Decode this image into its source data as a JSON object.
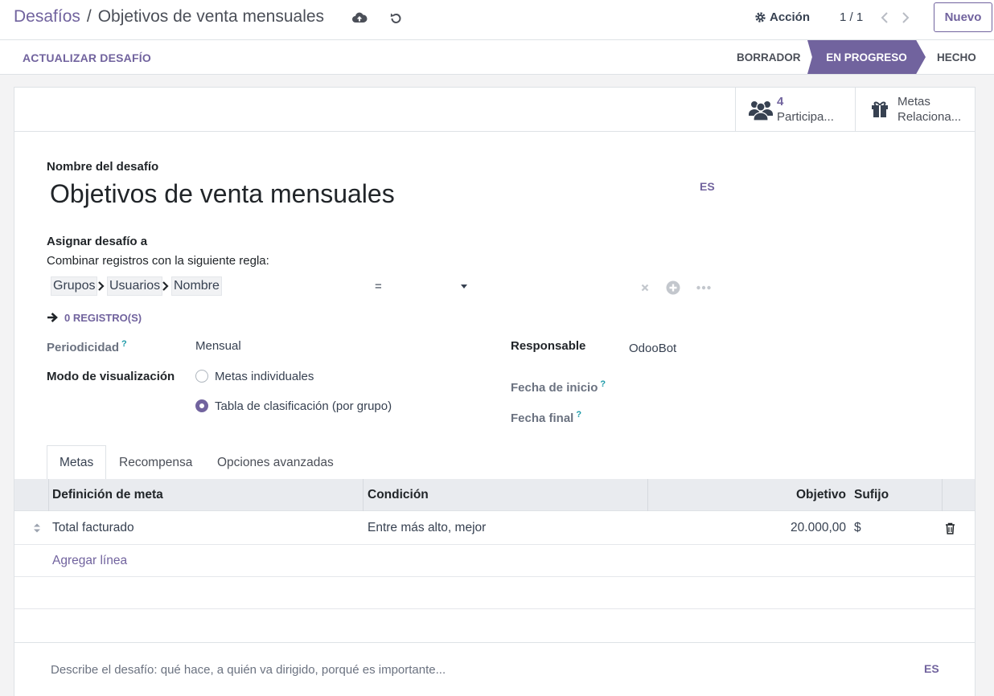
{
  "header": {
    "breadcrumb_parent": "Desafíos",
    "breadcrumb_separator": "/",
    "breadcrumb_current": "Objetivos de venta mensuales",
    "save_icon": "cloud-upload-icon",
    "discard_icon": "undo-icon",
    "action_label": "Acción",
    "pager": "1 / 1",
    "new_label": "Nuevo"
  },
  "statusbar": {
    "update_label": "ACTUALIZAR DESAFÍO",
    "stages": [
      "BORRADOR",
      "EN PROGRESO",
      "HECHO"
    ],
    "active_stage": "EN PROGRESO"
  },
  "smart_buttons": {
    "participants_count": "4",
    "participants_label": "Participa...",
    "goals_label_1": "Metas",
    "goals_label_2": "Relaciona..."
  },
  "form": {
    "name_label": "Nombre del desafío",
    "name_value": "Objetivos de venta mensuales",
    "lang_badge": "ES",
    "assign_label": "Asignar desafío a",
    "rule_label": "Combinar registros con la siguiente regla:",
    "domain_path": [
      "Grupos",
      "Usuarios",
      "Nombre"
    ],
    "domain_operator": "=",
    "records_label": "0 REGISTRO(S)",
    "period_label": "Periodicidad",
    "period_value": "Mensual",
    "display_label": "Modo de visualización",
    "display_options": [
      "Metas individuales",
      "Tabla de clasificación (por grupo)"
    ],
    "display_selected": 1,
    "responsible_label": "Responsable",
    "responsible_value": "OdooBot",
    "start_label": "Fecha de inicio",
    "end_label": "Fecha final",
    "help_mark": "?"
  },
  "tabs": [
    "Metas",
    "Recompensa",
    "Opciones avanzadas"
  ],
  "goals_table": {
    "columns": [
      "Definición de meta",
      "Condición",
      "Objetivo",
      "Sufijo"
    ],
    "rows": [
      {
        "definition": "Total facturado",
        "condition": "Entre más alto, mejor",
        "target": "20.000,00",
        "suffix": "$"
      }
    ],
    "add_line": "Agregar línea"
  },
  "description": {
    "placeholder": "Describe el desafío: qué hace, a quién va dirigido, porqué es importante...",
    "lang_badge": "ES"
  },
  "colors": {
    "brand": "#71639e",
    "help": "#1e9aa8"
  }
}
